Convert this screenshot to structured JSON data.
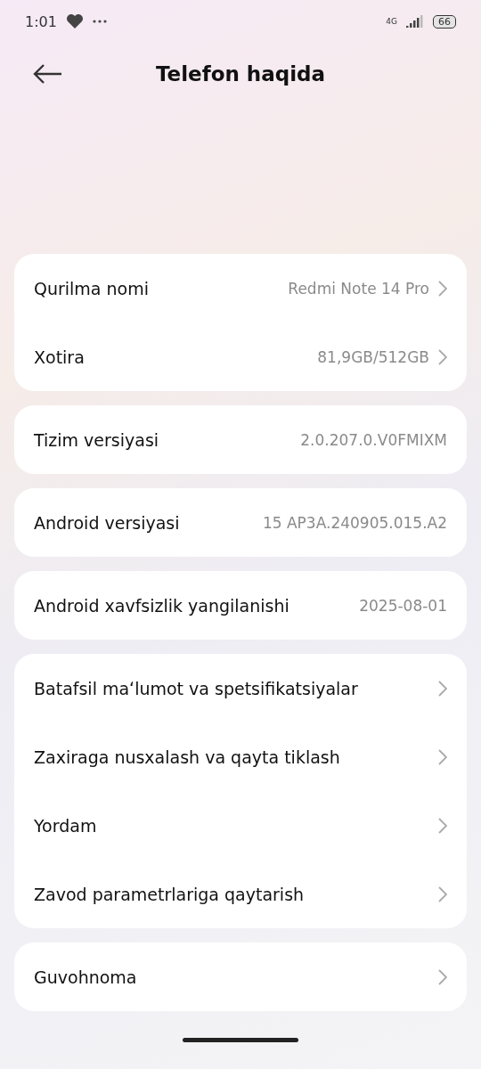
{
  "status_bar": {
    "time": "1:01",
    "network": "4G",
    "battery": "66"
  },
  "header": {
    "title": "Telefon haqida"
  },
  "groups": [
    {
      "rows": [
        {
          "label": "Qurilma nomi",
          "value": "Redmi Note 14 Pro",
          "chevron": true
        },
        {
          "label": "Xotira",
          "value": "81,9GB/512GB",
          "chevron": true
        }
      ]
    },
    {
      "rows": [
        {
          "label": "Tizim versiyasi",
          "value": "2.0.207.0.V0FMIXM",
          "chevron": false
        }
      ]
    },
    {
      "rows": [
        {
          "label": "Android versiyasi",
          "value": "15 AP3A.240905.015.A2",
          "chevron": false
        }
      ]
    },
    {
      "rows": [
        {
          "label": "Android xavfsizlik yangilanishi",
          "value": "2025-08-01",
          "chevron": false
        }
      ]
    },
    {
      "rows": [
        {
          "label": "Batafsil maʻlumot va spetsifikatsiyalar",
          "chevron": true
        },
        {
          "label": "Zaxiraga nusxalash va qayta tiklash",
          "chevron": true
        },
        {
          "label": "Yordam",
          "chevron": true
        },
        {
          "label": "Zavod parametrlariga qaytarish",
          "chevron": true
        }
      ]
    },
    {
      "rows": [
        {
          "label": "Guvohnoma",
          "chevron": true
        }
      ]
    }
  ]
}
